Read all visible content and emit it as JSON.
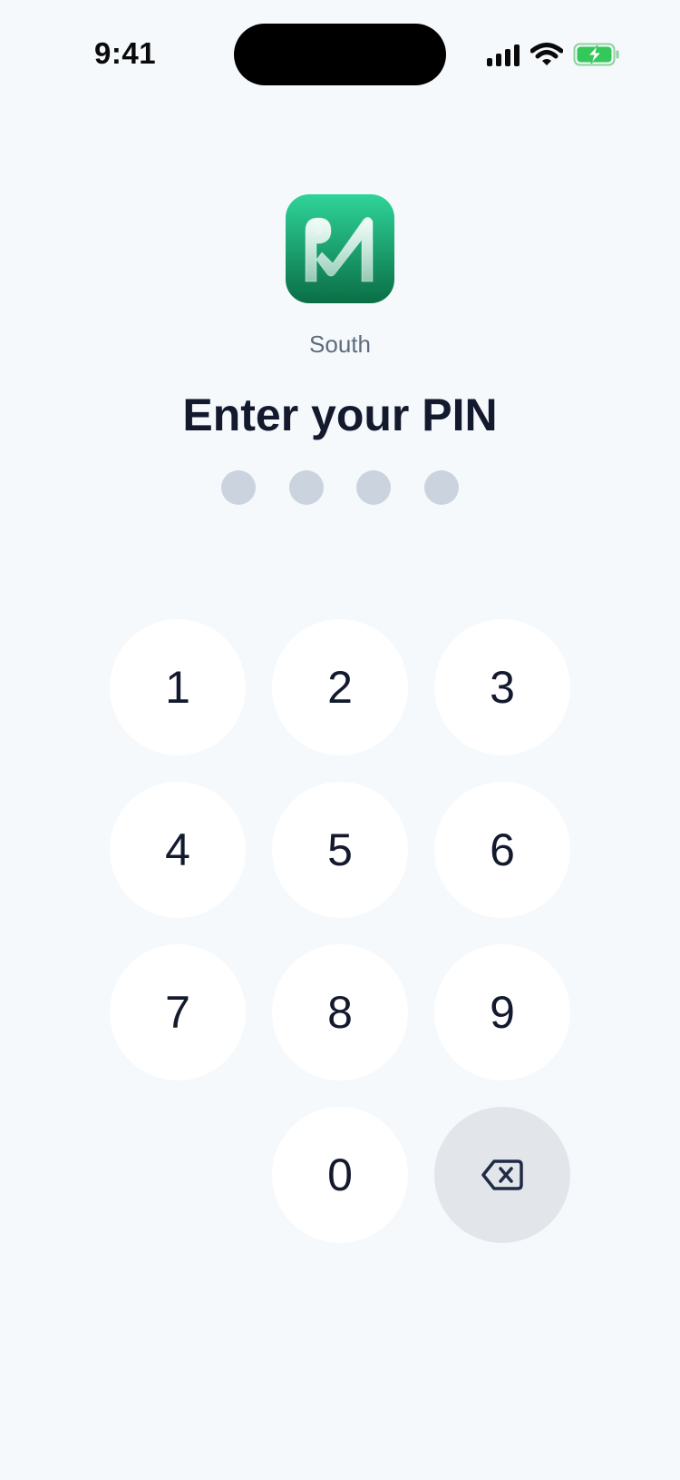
{
  "status_bar": {
    "time": "9:41",
    "icons": [
      "signal-icon",
      "wifi-icon",
      "battery-charging-icon"
    ]
  },
  "app": {
    "name": "South",
    "logo_icon": "app-logo-icon",
    "logo_colors": {
      "top": "#2fd49a",
      "bottom": "#0a6e45"
    }
  },
  "pin": {
    "title": "Enter your PIN",
    "length": 4,
    "entered": 0
  },
  "keypad": {
    "keys": [
      "1",
      "2",
      "3",
      "4",
      "5",
      "6",
      "7",
      "8",
      "9",
      "0"
    ],
    "delete_icon": "backspace-icon"
  },
  "colors": {
    "background": "#f5f9fc",
    "key_background": "#ffffff",
    "delete_key_background": "#e2e6ea",
    "dot_empty": "#cbd3df",
    "text_primary": "#141a2e",
    "text_secondary": "#5f6b7e"
  }
}
